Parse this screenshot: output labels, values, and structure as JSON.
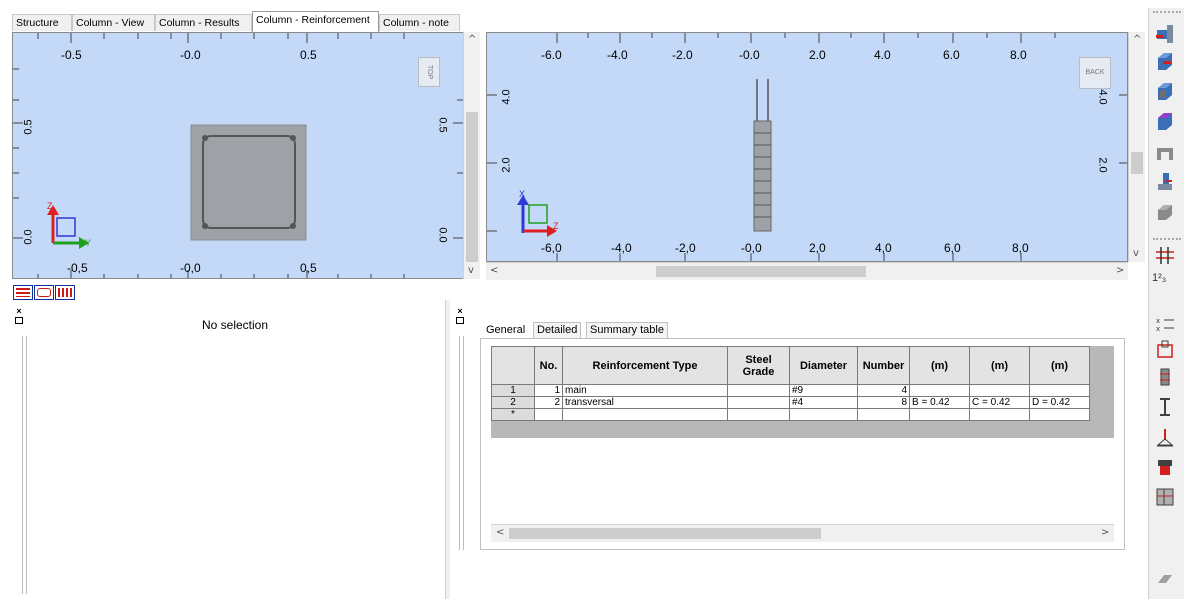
{
  "tabs": [
    "Structure",
    "Column - View",
    "Column - Results",
    "Column - Reinforcement",
    "Column - note"
  ],
  "active_tab_index": 3,
  "top_view": {
    "badge": "TOP",
    "x_ticks": [
      "-0.5",
      "-0.0",
      "0.5"
    ],
    "x_ticks_bottom": [
      "-0,5",
      "-0,0",
      "0,5"
    ],
    "y_ticks_left": [
      "0.5",
      "0.0"
    ],
    "y_ticks_right": [
      "0.5",
      "0.0"
    ],
    "axis_labels": {
      "vertical": "Z",
      "horizontal": "Y"
    }
  },
  "back_view": {
    "badge": "BACK",
    "x_ticks": [
      "-6.0",
      "-4.0",
      "-2.0",
      "-0.0",
      "2.0",
      "4.0",
      "6.0",
      "8.0"
    ],
    "x_ticks_bottom": [
      "-6,0",
      "-4,0",
      "-2,0",
      "-0,0",
      "2,0",
      "4,0",
      "6,0",
      "8,0"
    ],
    "y_ticks_left": [
      "4.0",
      "2.0"
    ],
    "y_ticks_right": [
      "4.0",
      "2.0"
    ],
    "axis_labels": {
      "vertical": "X",
      "horizontal": "Z"
    }
  },
  "left_panel": {
    "message": "No selection"
  },
  "sub_tabs": [
    "General",
    "Detailed",
    "Summary table"
  ],
  "table": {
    "headers": [
      "",
      "No.",
      "Reinforcement Type",
      "Steel Grade",
      "Diameter",
      "Number",
      "(m)",
      "(m)",
      "(m)"
    ],
    "rows": [
      [
        "1",
        "1",
        "main",
        "",
        "#9",
        "4",
        "",
        "",
        ""
      ],
      [
        "2",
        "2",
        "transversal",
        "",
        "#4",
        "8",
        "B = 0.42",
        "C = 0.42",
        "D = 0.42"
      ],
      [
        "*",
        "",
        "",
        "",
        "",
        "",
        "",
        "",
        ""
      ]
    ]
  },
  "toolbar_icons": [
    "beam-view-icon",
    "column-3d-icon",
    "column-section-icon",
    "slab-icon",
    "wall-icon",
    "foundation-icon",
    "beam-gray-icon",
    "rebar-grid-icon",
    "numbering-icon",
    "dimension-icon",
    "section-cut-icon",
    "pile-icon",
    "i-beam-icon",
    "support-icon",
    "load-icon",
    "frame-icon",
    "eraser-icon"
  ],
  "numbering_label": "1²₃",
  "colors": {
    "viewport_bg": "#c4d9f8",
    "column_fill": "#9ea1a6"
  }
}
